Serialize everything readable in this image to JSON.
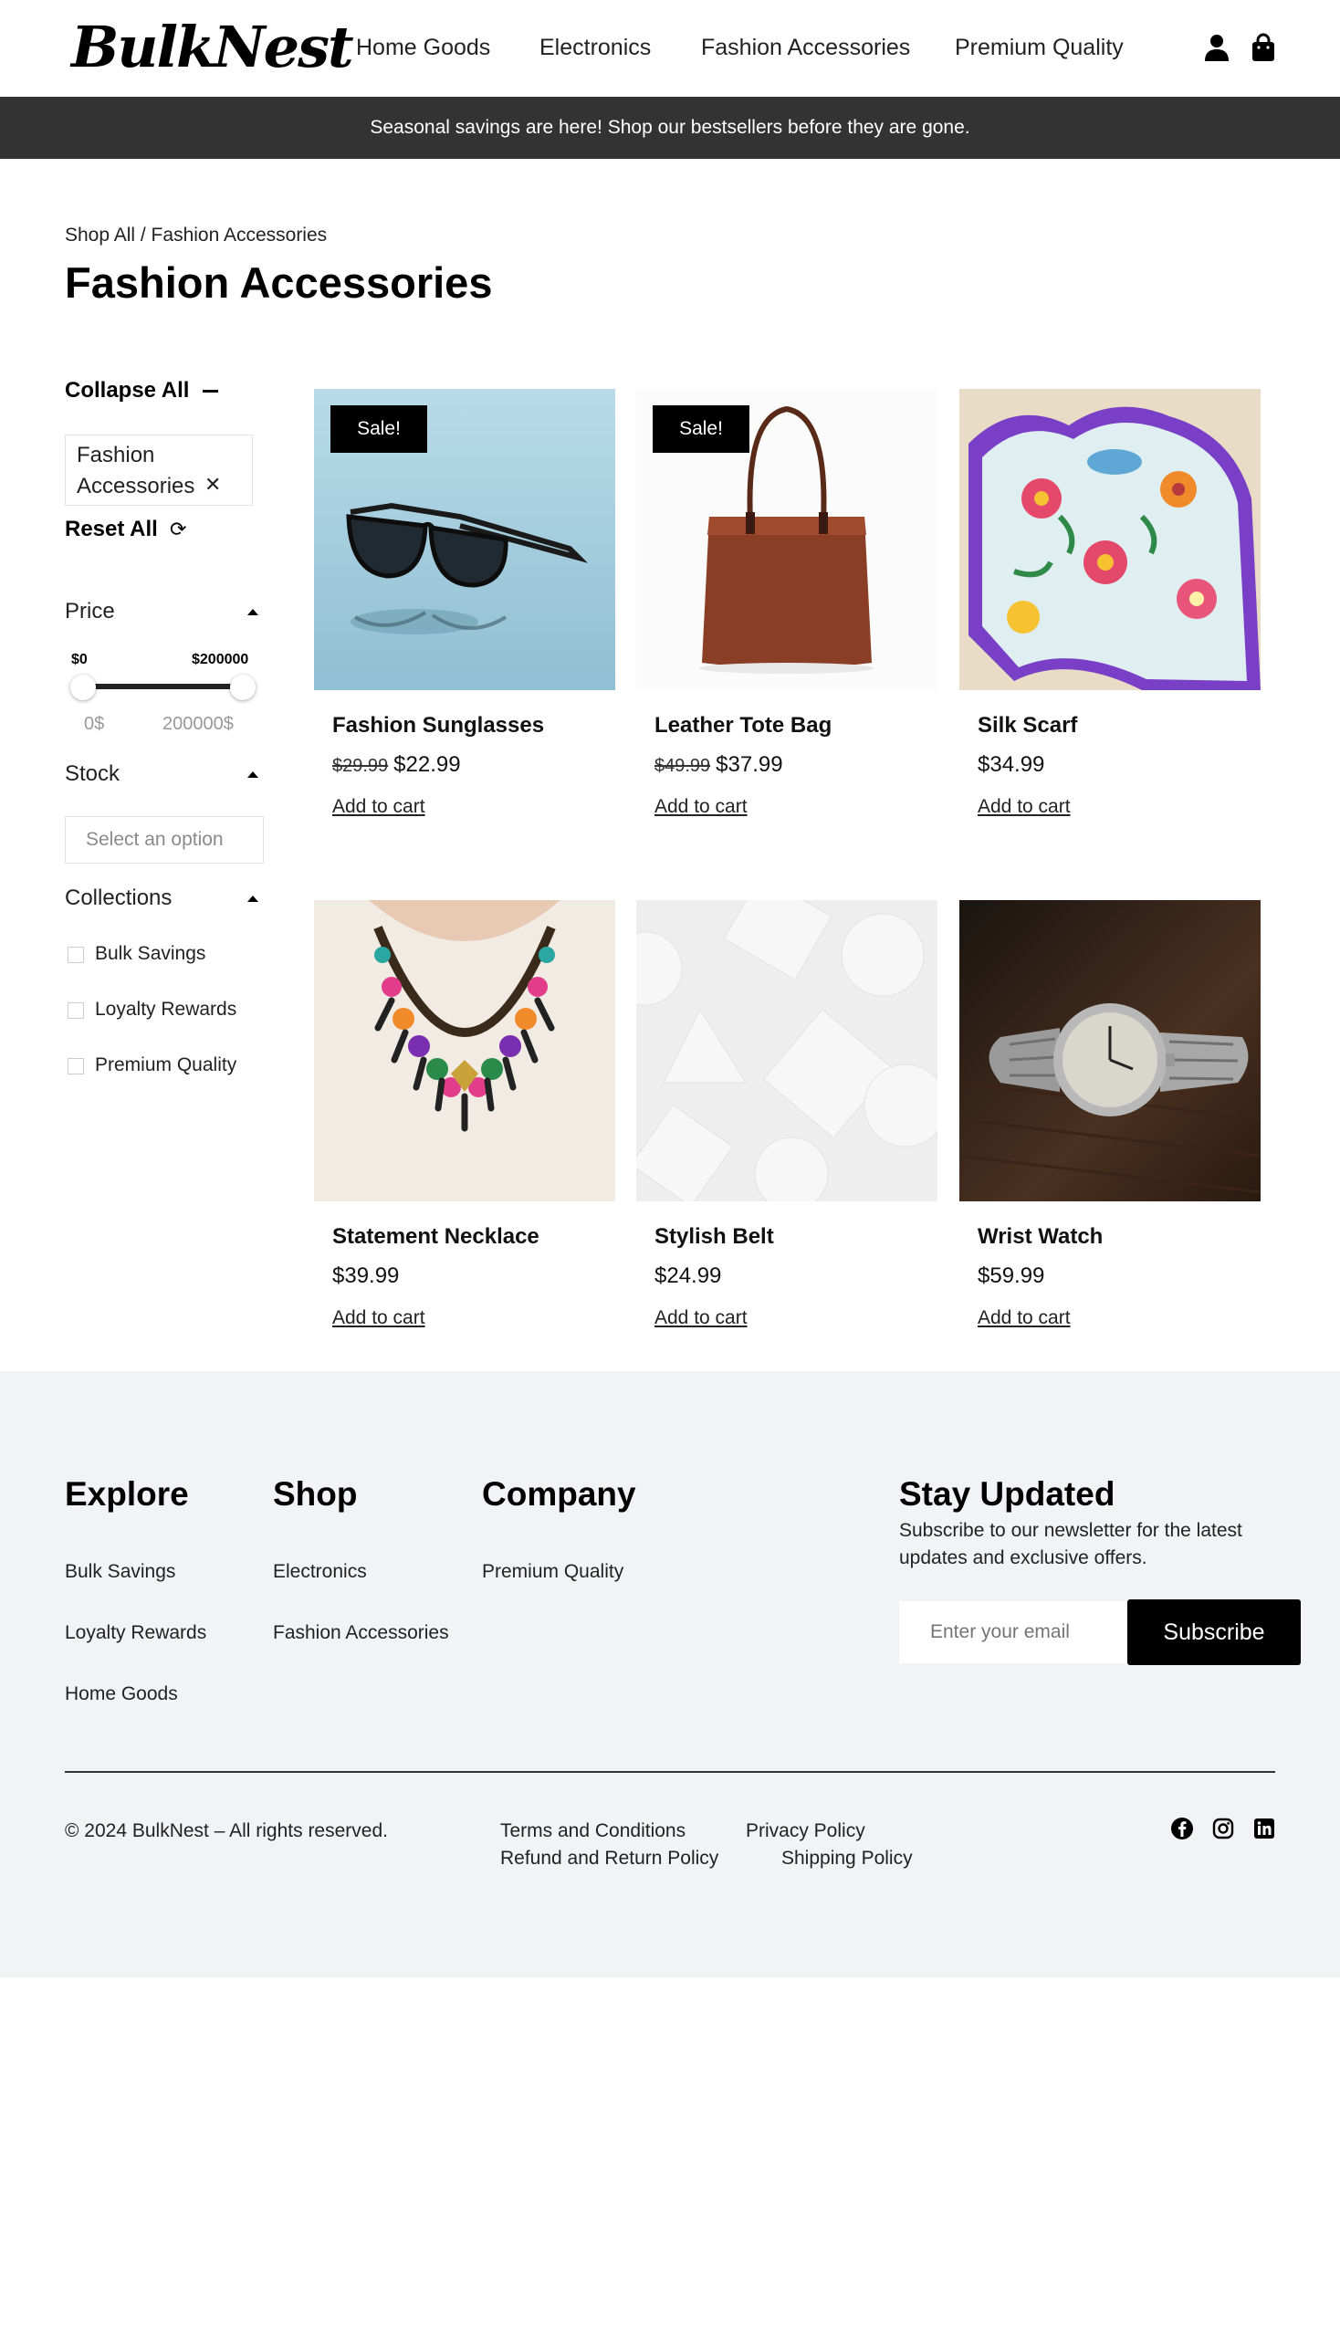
{
  "header": {
    "logo": "BulkNest",
    "nav": [
      "Home Goods",
      "Electronics",
      "Fashion Accessories",
      "Premium Quality"
    ],
    "icons": [
      "account-icon",
      "shopping-bag-icon"
    ]
  },
  "announcement": "Seasonal savings are here! Shop our bestsellers before they are gone.",
  "breadcrumb": "Shop All / Fashion Accessories",
  "page_title": "Fashion Accessories",
  "filters": {
    "collapse_all": "Collapse All",
    "active_chip": "Fashion Accessories",
    "reset_all": "Reset All",
    "price": {
      "label": "Price",
      "min_label": "$0",
      "max_label": "$200000",
      "min_input": "0$",
      "max_input": "200000$"
    },
    "stock": {
      "label": "Stock",
      "placeholder": "Select an option"
    },
    "collections": {
      "label": "Collections",
      "options": [
        "Bulk Savings",
        "Loyalty Rewards",
        "Premium Quality"
      ]
    }
  },
  "products": [
    {
      "name": "Fashion Sunglasses",
      "badge": "Sale!",
      "old_price": "$29.99",
      "price": "$22.99",
      "cta": "Add to cart"
    },
    {
      "name": "Leather Tote Bag",
      "badge": "Sale!",
      "old_price": "$49.99",
      "price": "$37.99",
      "cta": "Add to cart"
    },
    {
      "name": "Silk Scarf",
      "price": "$34.99",
      "cta": "Add to cart"
    },
    {
      "name": "Statement Necklace",
      "price": "$39.99",
      "cta": "Add to cart"
    },
    {
      "name": "Stylish Belt",
      "price": "$24.99",
      "cta": "Add to cart"
    },
    {
      "name": "Wrist Watch",
      "price": "$59.99",
      "cta": "Add to cart"
    }
  ],
  "footer": {
    "explore": {
      "title": "Explore",
      "links": [
        "Bulk Savings",
        "Loyalty Rewards",
        "Home Goods"
      ]
    },
    "shop": {
      "title": "Shop",
      "links": [
        "Electronics",
        "Fashion Accessories"
      ]
    },
    "company": {
      "title": "Company",
      "links": [
        "Premium Quality"
      ]
    },
    "newsletter": {
      "title": "Stay Updated",
      "text": "Subscribe to our newsletter for the latest updates and exclusive offers.",
      "placeholder": "Enter your email",
      "button": "Subscribe"
    },
    "copyright": "© 2024 BulkNest – All rights reserved.",
    "legal": [
      "Terms and Conditions",
      "Privacy Policy",
      "Refund and Return Policy",
      "Shipping Policy"
    ],
    "social": [
      "facebook-icon",
      "instagram-icon",
      "linkedin-icon"
    ]
  }
}
